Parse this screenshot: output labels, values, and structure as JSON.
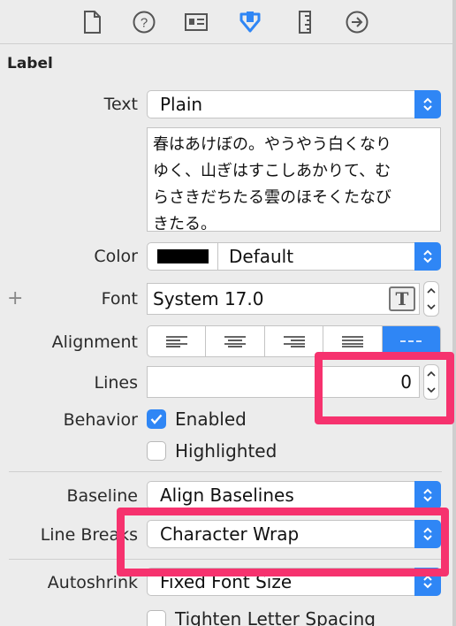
{
  "toolbar": {
    "icons": [
      "file-inspector-icon",
      "quick-help-icon",
      "identity-inspector-icon",
      "attributes-inspector-icon",
      "size-inspector-icon",
      "connections-inspector-icon"
    ],
    "active_color": "#2f86f5"
  },
  "section": {
    "title": "Label"
  },
  "text_row": {
    "label": "Text",
    "value": "Plain"
  },
  "text_content": "春はあけぼの。やうやう白くなり\nゆく、山ぎはすこしあかりて、む\nらさきだちたる雲のほそくたなび\nきたる。",
  "color_row": {
    "label": "Color",
    "value": "Default",
    "swatch": "#000000"
  },
  "font_row": {
    "label": "Font",
    "value": "System 17.0",
    "add_symbol": "+",
    "font_button_glyph": "T"
  },
  "alignment_row": {
    "label": "Alignment",
    "options": [
      "left",
      "center",
      "right",
      "justified",
      "natural"
    ],
    "selected": 4
  },
  "lines_row": {
    "label": "Lines",
    "value": "0"
  },
  "behavior_row": {
    "label": "Behavior",
    "enabled": {
      "label": "Enabled",
      "checked": true
    },
    "highlighted": {
      "label": "Highlighted",
      "checked": false
    }
  },
  "baseline_row": {
    "label": "Baseline",
    "value": "Align Baselines"
  },
  "line_breaks_row": {
    "label": "Line Breaks",
    "value": "Character Wrap"
  },
  "autoshrink_row": {
    "label": "Autoshrink",
    "value": "Fixed Font Size"
  },
  "tighten_row": {
    "label": "Tighten Letter Spacing",
    "checked": false
  },
  "colors": {
    "accent": "#2f86f5",
    "annotation": "#f6326e"
  }
}
